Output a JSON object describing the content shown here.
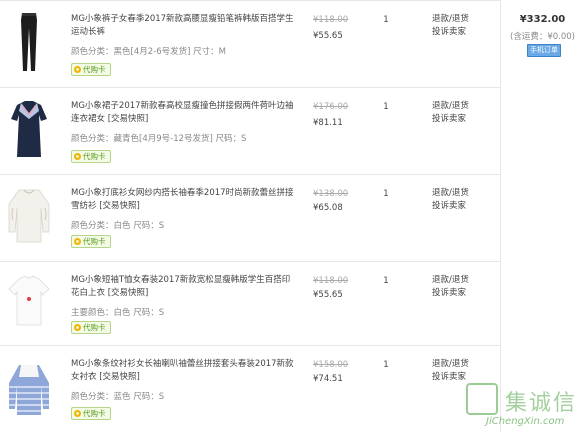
{
  "items": [
    {
      "title": "MG小象裤子女春季2017新款高腰显瘦铅笔裤韩版百搭学生运动长裤",
      "sku": "颜色分类：黑色[4月2-6号发货]  尺寸：M",
      "badge": "代购卡",
      "original_price": "¥118.00",
      "price": "¥55.65",
      "qty": "1",
      "actions": [
        "退款/退货",
        "投诉卖家"
      ],
      "image_icon": "black-pants-thumbnail"
    },
    {
      "title": "MG小象裙子2017新款春高校显瘦撞色拼接假两件荷叶边袖连衣裙女 [交易快照]",
      "sku": "颜色分类：藏青色[4月9号-12号发货]  尺码：S",
      "badge": "代购卡",
      "original_price": "¥176.00",
      "price": "¥81.11",
      "qty": "1",
      "actions": [
        "退款/退货",
        "投诉卖家"
      ],
      "image_icon": "navy-dress-thumbnail"
    },
    {
      "title": "MG小象打底衫女网纱内搭长袖春季2017时尚新款蕾丝拼接雪纺衫 [交易快照]",
      "sku": "颜色分类：白色  尺码：S",
      "badge": "代购卡",
      "original_price": "¥138.00",
      "price": "¥65.08",
      "qty": "1",
      "actions": [
        "退款/退货",
        "投诉卖家"
      ],
      "image_icon": "white-blouse-thumbnail"
    },
    {
      "title": "MG小象短袖T恤女春装2017新款宽松显瘦韩版学生百搭印花白上衣 [交易快照]",
      "sku": "主要颜色：白色  尺码：S",
      "badge": "代购卡",
      "original_price": "¥118.00",
      "price": "¥55.65",
      "qty": "1",
      "actions": [
        "退款/退货",
        "投诉卖家"
      ],
      "image_icon": "white-tshirt-thumbnail"
    },
    {
      "title": "MG小象条纹衬衫女长袖喇叭袖蕾丝拼接套头春装2017新款女衬衣 [交易快照]",
      "sku": "颜色分类：蓝色  尺码：S",
      "badge": "代购卡",
      "original_price": "¥158.00",
      "price": "¥74.51",
      "qty": "1",
      "actions": [
        "退款/退货",
        "投诉卖家"
      ],
      "image_icon": "striped-shirt-thumbnail"
    }
  ],
  "order": {
    "total": "¥332.00",
    "postage": "(含运费：¥0.00)",
    "mobile_button": "手机订单"
  },
  "watermark": {
    "chinese": "集诚信",
    "english": "JiChengXin.com"
  },
  "colors": {
    "border": "#e6e6e6",
    "strike": "#aaaaaa",
    "badge_green": "#5a9a1b",
    "button_blue": "#69a9e6"
  }
}
